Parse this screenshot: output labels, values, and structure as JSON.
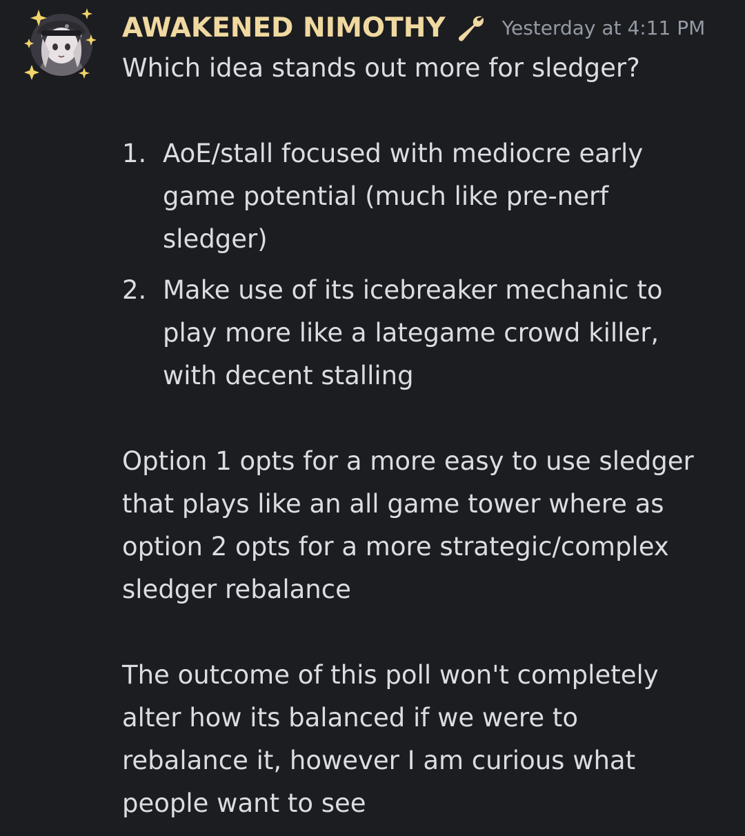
{
  "message": {
    "author": "AWAKENED NIMOTHY",
    "author_icon": "wrench-icon",
    "timestamp": "Yesterday at 4:11 PM",
    "intro": "Which idea stands out more for sledger?",
    "options": [
      {
        "number": "1.",
        "lines": [
          "AoE/stall focused with mediocre early",
          "game potential (much like pre-nerf",
          "sledger)"
        ]
      },
      {
        "number": "2.",
        "lines": [
          "Make use of its icebreaker mechanic to",
          "play more like a lategame crowd killer,",
          "with decent stalling"
        ]
      }
    ],
    "paragraph_1": [
      "Option 1 opts for a more easy to use sledger",
      "that plays like an all game tower where as",
      "option 2 opts for a more strategic/complex",
      "sledger rebalance"
    ],
    "paragraph_2": [
      "The outcome of this poll won't completely",
      "alter how its balanced if we were to",
      "rebalance it, however I am curious what",
      "people want to see"
    ]
  },
  "colors": {
    "background": "#1c1d21",
    "username": "#f0d9a0",
    "text": "#dbdee1",
    "timestamp": "#949ba4"
  }
}
